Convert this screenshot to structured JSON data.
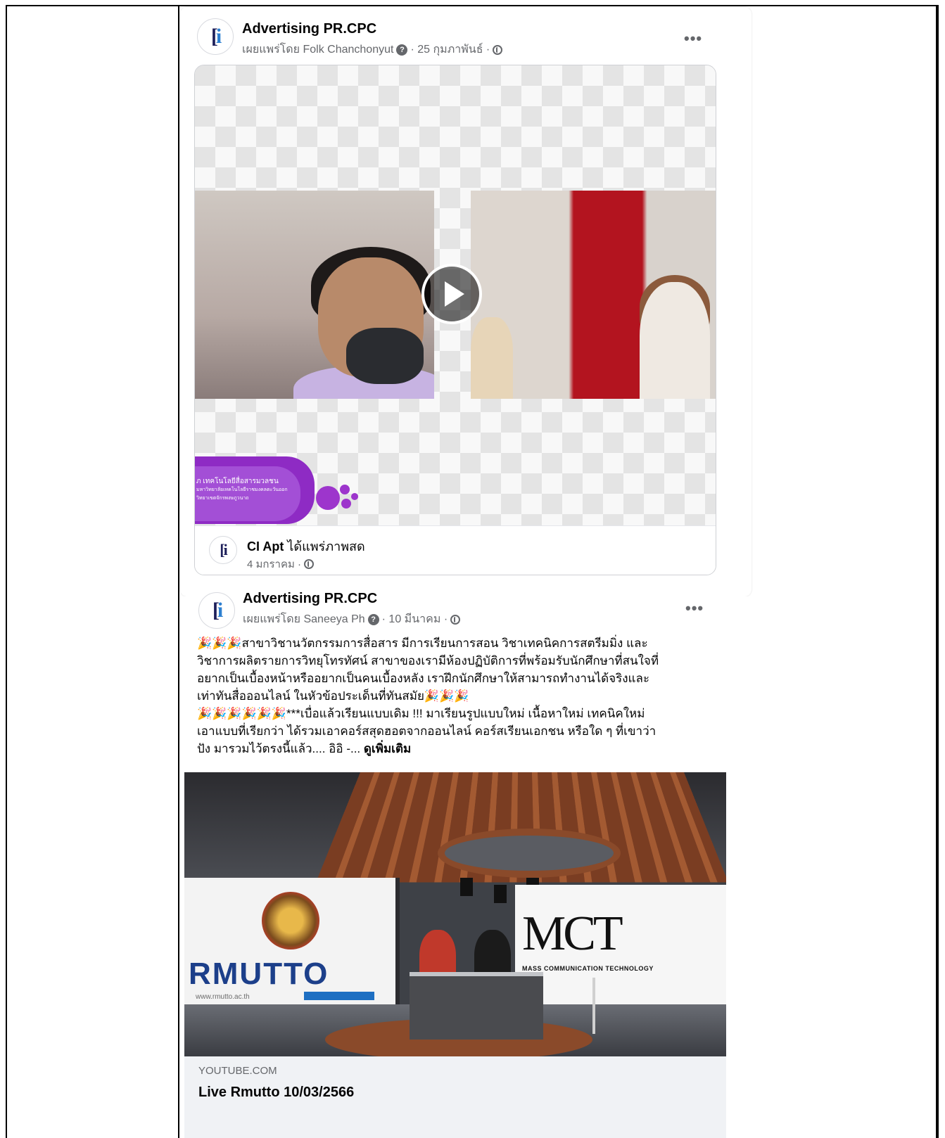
{
  "posts": [
    {
      "page_name": "Advertising PR.CPC",
      "author_line": "เผยแพร่โดย Folk Chanchonyut",
      "date": "· 25 กุมภาพันธ์ ·",
      "more_label": "•••",
      "video": {
        "banner_line1": "ภ เทคโนโลยีสื่อสารมวลชน",
        "banner_line2": "มหาวิทยาลัยเทคโนโลยีราชมงคลตะวันออก",
        "banner_line3": "วิทยาเขตจักรพงษภูวนาถ"
      },
      "shared": {
        "name": "CI Apt",
        "action": "ได้แพร่ภาพสด",
        "date": "4 มกราคม ·"
      }
    },
    {
      "page_name": "Advertising PR.CPC",
      "author_line": "เผยแพร่โดย Saneeya Ph",
      "date": "· 10 มีนาคม ·",
      "more_label": "•••",
      "text_lines": [
        "🎉🎉🎉สาขาวิชานวัตกรรมการสื่อสาร มีการเรียนการสอน วิชาเทคนิคการสตรีมมิ่ง และ",
        "วิชาการผลิตรายการวิทยุโทรทัศน์ สาขาของเรามีห้องปฏิบัติการที่พร้อมรับนักศึกษาที่สนใจที่",
        "อยากเป็นเบื้องหน้าหรืออยากเป็นคนเบื้องหลัง เราฝึกนักศึกษาให้สามารถทำงานได้จริงและ",
        "เท่าทันสื่อออนไลน์ ในหัวข้อประเด็นที่ทันสมัย🎉🎉🎉",
        "🎉🎉🎉🎉🎉🎉***เบื่อแล้วเรียนแบบเดิม !!! มาเรียนรูปแบบใหม่ เนื้อหาใหม่ เทคนิคใหม่",
        "เอาแบบที่เรียกว่า ได้รวมเอาคอร์สสุดฮอตจากออนไลน์ คอร์สเรียนเอกชน หรือใด ๆ ที่เขาว่า",
        "ปัง มารวมไว้ตรงนี้แล้ว.... อิอิ -..."
      ],
      "see_more": "ดูเพิ่มเติม",
      "link_image": {
        "rmutto_logo": "RMUTTO",
        "rmutto_url": "www.rmutto.ac.th",
        "mct_logo": "MCT",
        "mct_sub": "MASS COMMUNICATION TECHNOLOGY"
      },
      "link": {
        "domain": "YOUTUBE.COM",
        "title": "Live Rmutto 10/03/2566"
      }
    }
  ],
  "colors": {
    "secondary_text": "#65676b",
    "primary_text": "#050505",
    "link_bg": "#f0f2f5",
    "banner_purple": "#8e2bc4"
  },
  "icons": {
    "info": "question-circle-icon",
    "audience": "globe-icon",
    "play": "play-icon",
    "more": "more-horizontal-icon"
  }
}
